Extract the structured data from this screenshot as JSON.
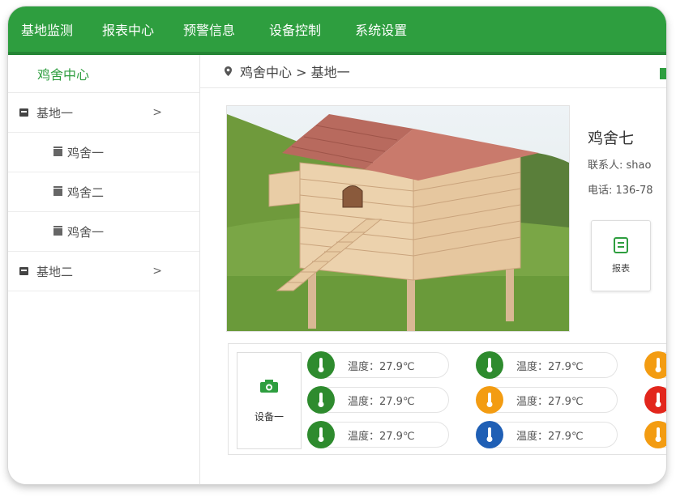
{
  "topnav": {
    "items": [
      "基地监测",
      "报表中心",
      "预警信息",
      "设备控制",
      "系统设置"
    ]
  },
  "sidebar": {
    "title": "鸡舍中心",
    "rows": [
      {
        "label": "基地一",
        "kind": "base",
        "arrow": ">"
      },
      {
        "label": "鸡舍一",
        "kind": "coop"
      },
      {
        "label": "鸡舍二",
        "kind": "coop"
      },
      {
        "label": "鸡舍一",
        "kind": "coop"
      },
      {
        "label": "基地二",
        "kind": "base",
        "arrow": ">"
      }
    ]
  },
  "breadcrumb": {
    "text": "鸡舍中心 > 基地一"
  },
  "coop_info": {
    "name": "鸡舍七",
    "contact": "联系人: shao",
    "phone": "电话: 136-78"
  },
  "report_button": {
    "label": "报表"
  },
  "device": {
    "label": "设备一",
    "sensors": [
      {
        "text": "温度：27.9℃",
        "color": "#2e8b2e"
      },
      {
        "text": "温度：27.9℃",
        "color": "#2e8b2e"
      },
      {
        "text": "",
        "color": "#f39c12"
      },
      {
        "text": "温度：27.9℃",
        "color": "#2e8b2e"
      },
      {
        "text": "温度：27.9℃",
        "color": "#f39c12"
      },
      {
        "text": "",
        "color": "#e2261c"
      },
      {
        "text": "温度：27.9℃",
        "color": "#2e8b2e"
      },
      {
        "text": "温度：27.9℃",
        "color": "#1f5fb5"
      },
      {
        "text": "",
        "color": "#f39c12"
      }
    ]
  }
}
